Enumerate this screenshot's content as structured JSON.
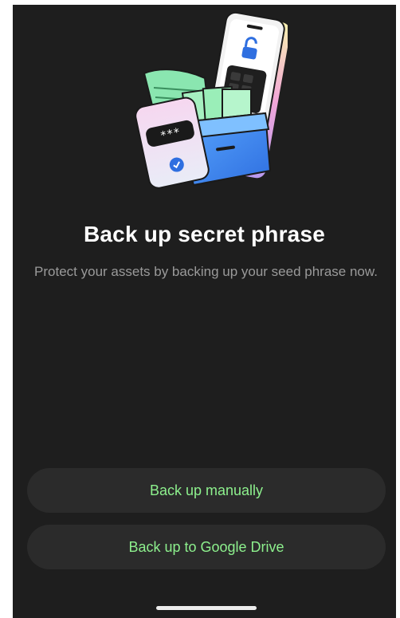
{
  "screen": {
    "title": "Back up secret phrase",
    "subtitle": "Protect your assets by backing up your seed phrase now.",
    "buttons": {
      "manual_label": "Back up manually",
      "google_drive_label": "Back up to Google Drive"
    },
    "illustration": {
      "icon": "backup-illustration",
      "password_mask": "***"
    }
  },
  "colors": {
    "background": "#1e1e1e",
    "button_background": "#2b2b2b",
    "accent_green": "#8df08d",
    "subtitle_gray": "#9a9a9a"
  }
}
